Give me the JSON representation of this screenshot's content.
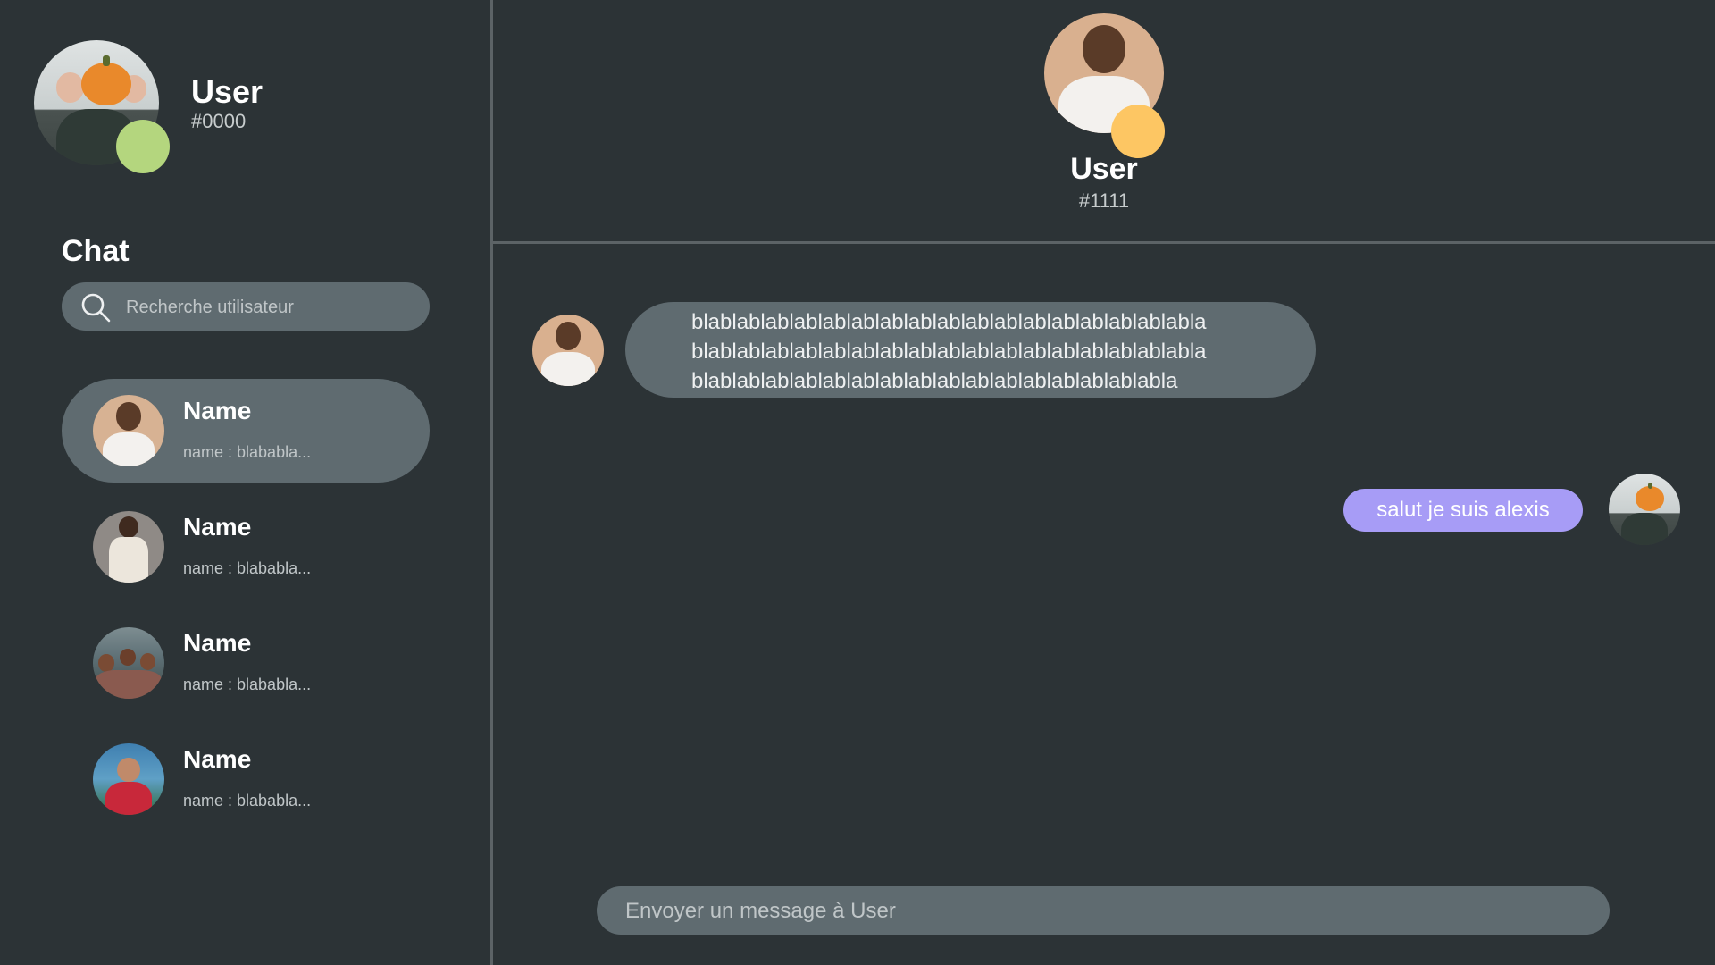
{
  "me": {
    "name": "User",
    "tag": "#0000",
    "status_color": "#b4d67e"
  },
  "sidebar": {
    "title": "Chat",
    "search_placeholder": "Recherche utilisateur",
    "contacts": [
      {
        "name": "Name",
        "preview": "name : blababla...",
        "active": true
      },
      {
        "name": "Name",
        "preview": "name : blababla...",
        "active": false
      },
      {
        "name": "Name",
        "preview": "name : blababla...",
        "active": false
      },
      {
        "name": "Name",
        "preview": "name : blababla...",
        "active": false
      }
    ]
  },
  "conversation": {
    "peer": {
      "name": "User",
      "tag": "#1111",
      "status_color": "#fdc663"
    },
    "messages": [
      {
        "direction": "incoming",
        "lines": [
          "blablablablablablablablablablablablablablablablablabla",
          "blablablablablablablablablablablablablablablablablabla",
          "blablablablablablablablablablablablablablablablabla"
        ]
      },
      {
        "direction": "outgoing",
        "text": "salut je suis alexis",
        "bubble_color": "#a79cf6"
      }
    ],
    "composer_placeholder": "Envoyer un message à User"
  },
  "icons": {
    "search": "search-icon"
  },
  "colors": {
    "background": "#2c3336",
    "panel": "#5f6b70",
    "divider": "#5c6366"
  }
}
